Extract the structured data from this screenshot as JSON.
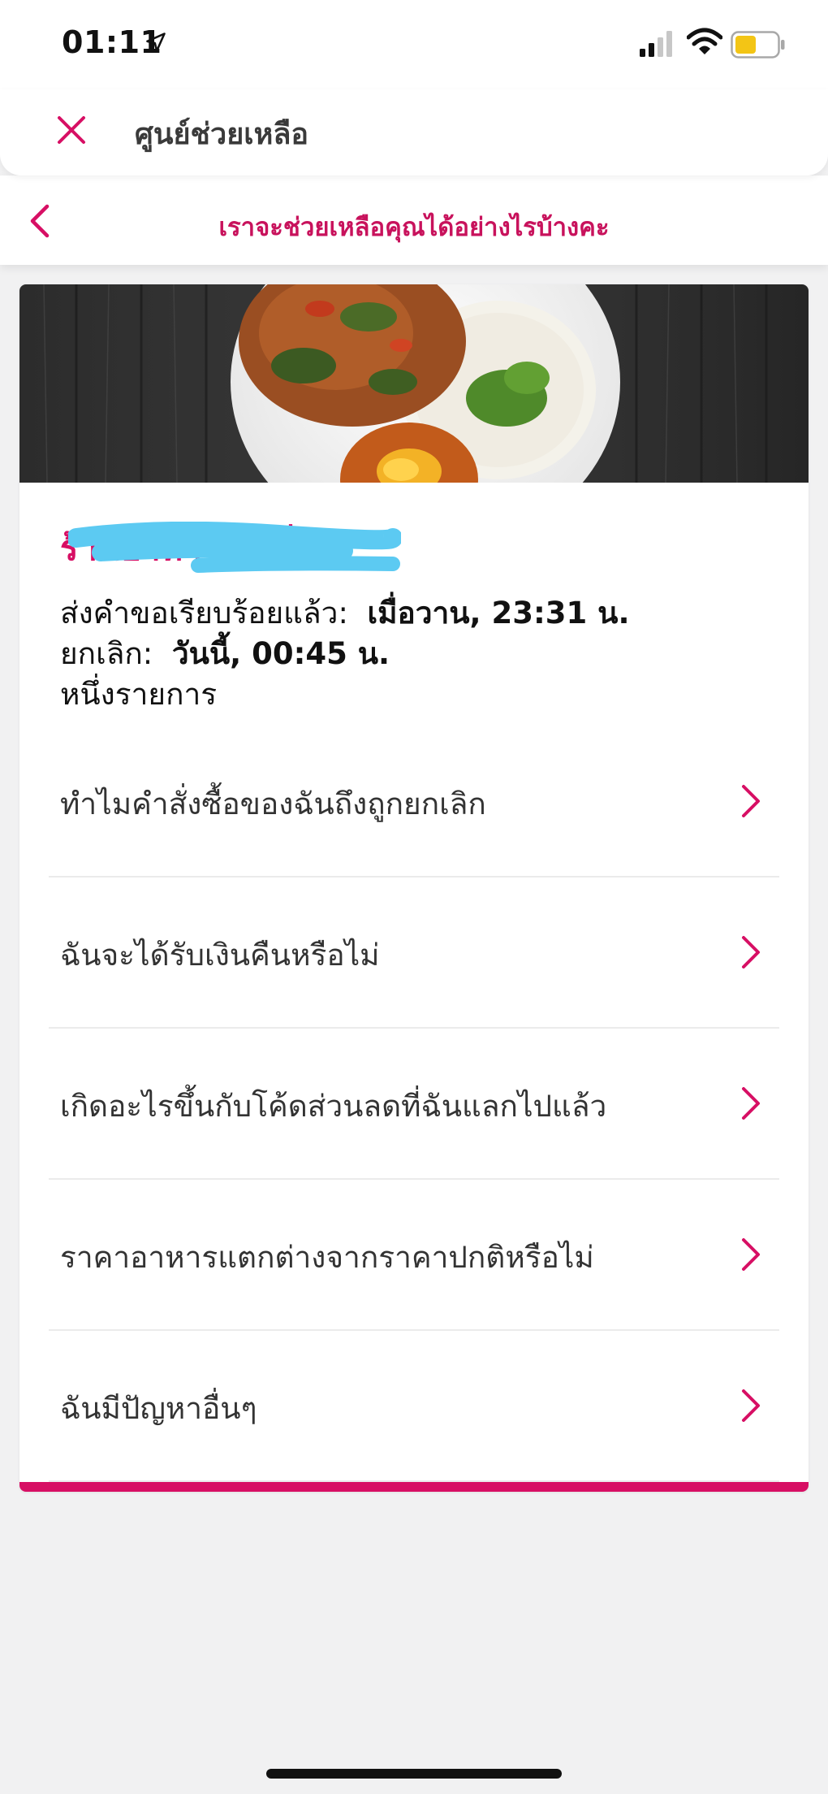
{
  "status_bar": {
    "time": "01:11",
    "icons": [
      "location-arrow-icon",
      "signal-icon",
      "wifi-icon",
      "battery-icon"
    ]
  },
  "header": {
    "title": "ศูนย์ช่วยเหลือ",
    "close_icon": "close-icon"
  },
  "subheader": {
    "title": "เราจะช่วยเหลือคุณได้อย่างไรบ้างคะ",
    "back_icon": "chevron-left-icon"
  },
  "order": {
    "restaurant_name": "ร้านอาหาร คำสั่ง",
    "submitted_label": "ส่งคำขอเรียบร้อยแล้ว:",
    "submitted_value": "เมื่อวาน, 23:31 น.",
    "cancelled_label": "ยกเลิก:",
    "cancelled_value": "วันนี้, 00:45 น.",
    "item_count": "หนึ่งรายการ"
  },
  "faq": [
    {
      "label": "ทำไมคำสั่งซื้อของฉันถึงถูกยกเลิก"
    },
    {
      "label": "ฉันจะได้รับเงินคืนหรือไม่"
    },
    {
      "label": "เกิดอะไรขึ้นกับโค้ดส่วนลดที่ฉันแลกไปแล้ว"
    },
    {
      "label": "ราคาอาหารแตกต่างจากราคาปกติหรือไม่"
    },
    {
      "label": "ฉันมีปัญหาอื่นๆ"
    }
  ],
  "colors": {
    "brand": "#d70f64",
    "redaction": "#5ccaf2",
    "background": "#f1f1f2"
  }
}
